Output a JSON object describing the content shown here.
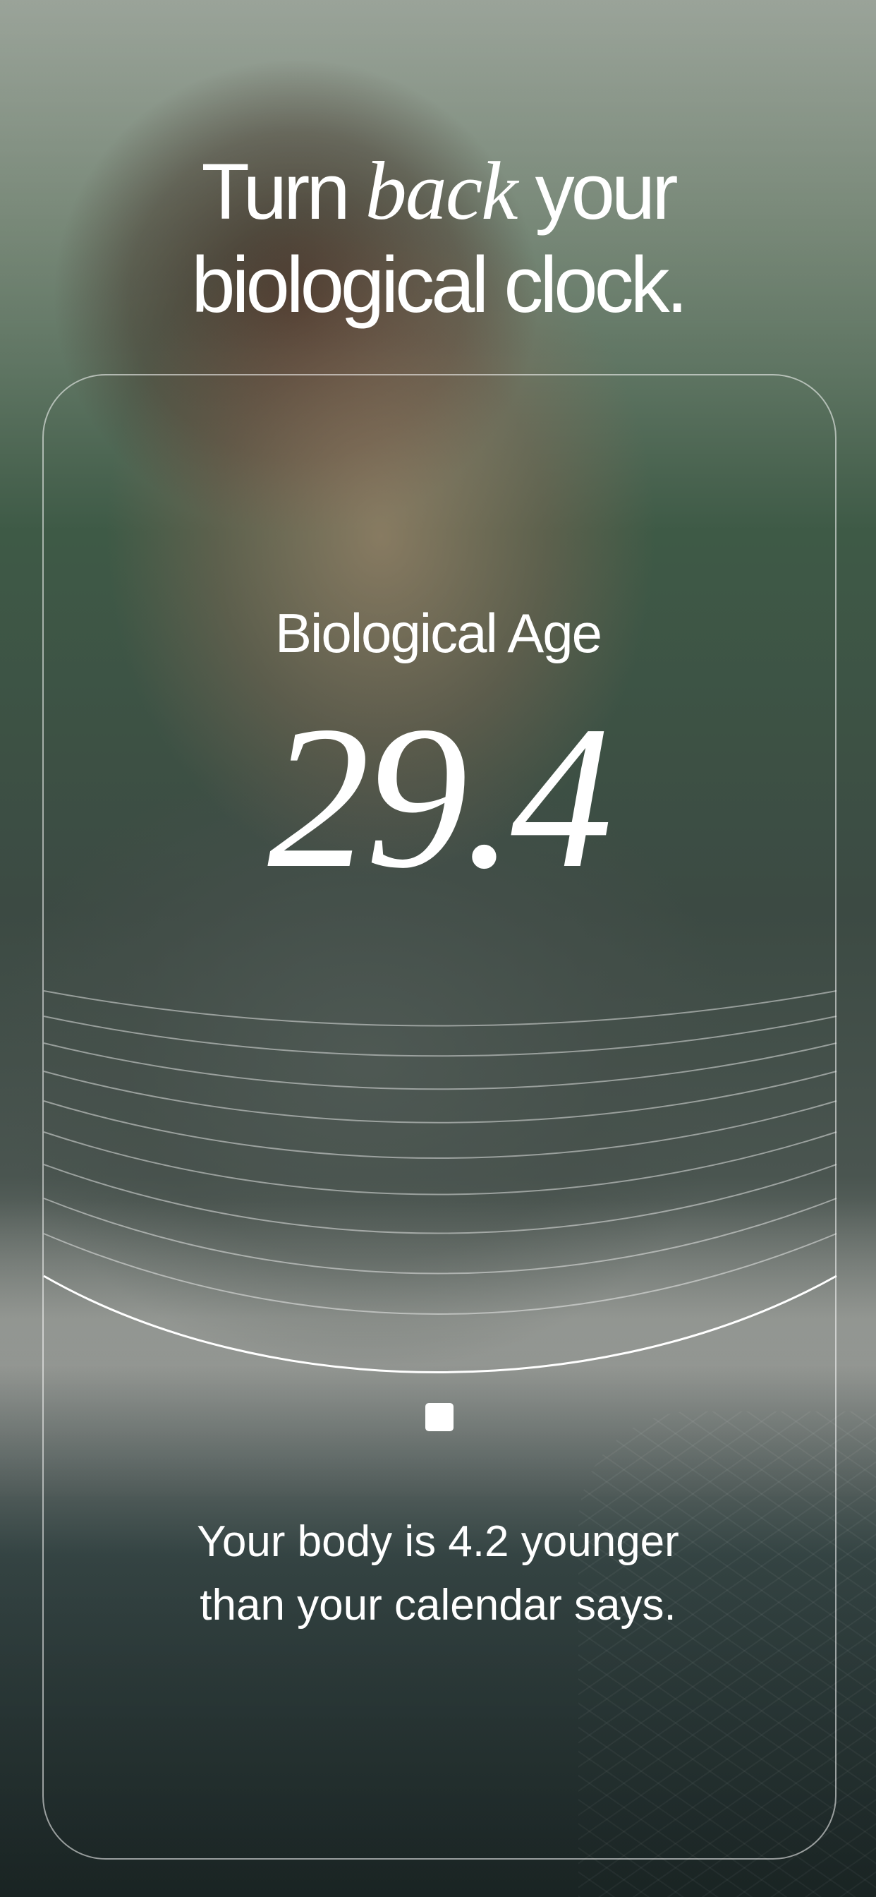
{
  "headline": {
    "line1_before": "Turn",
    "line1_italic": "back",
    "line1_after": "your",
    "line2": "biological clock."
  },
  "metric": {
    "label": "Biological Age",
    "value": "29.4"
  },
  "caption": {
    "line1": "Your body is 4.2 younger",
    "line2": "than your calendar says."
  },
  "chart": {
    "marker_icon": "square-marker-icon"
  },
  "colors": {
    "text": "#ffffff",
    "frame": "rgba(255,255,255,0.55)"
  }
}
